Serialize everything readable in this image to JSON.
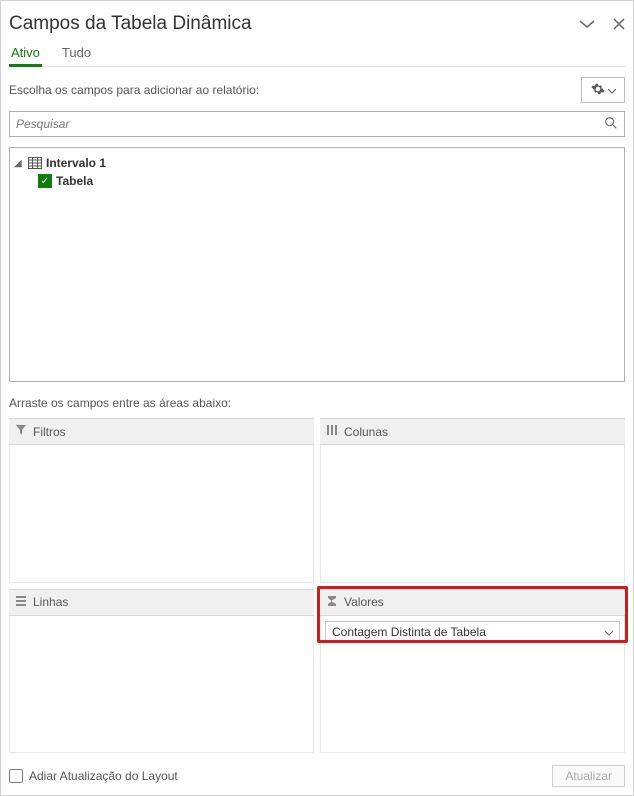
{
  "header": {
    "title": "Campos da Tabela Dinâmica"
  },
  "tabs": {
    "active": "Ativo",
    "all": "Tudo"
  },
  "instruction": "Escolha os campos para adicionar ao relatório:",
  "search": {
    "placeholder": "Pesquisar"
  },
  "fields": {
    "group": "Intervalo 1",
    "item": "Tabela"
  },
  "drag_instruction": "Arraste os campos entre as áreas abaixo:",
  "areas": {
    "filters": {
      "label": "Filtros"
    },
    "columns": {
      "label": "Colunas"
    },
    "rows": {
      "label": "Linhas"
    },
    "values": {
      "label": "Valores",
      "item": "Contagem Distinta de Tabela"
    }
  },
  "footer": {
    "defer": "Adiar Atualização do Layout",
    "update": "Atualizar"
  }
}
